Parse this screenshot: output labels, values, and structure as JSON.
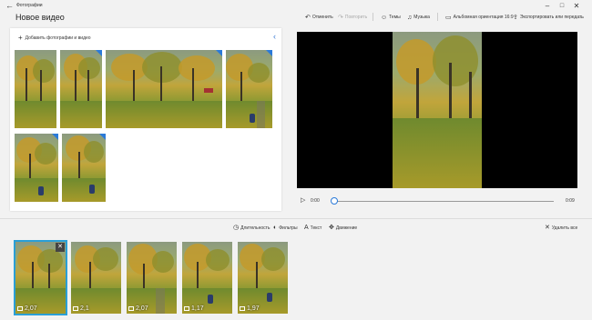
{
  "window": {
    "app_title": "Фотографии",
    "back_icon": "back-arrow-icon",
    "controls": [
      "minimize-icon",
      "maximize-icon",
      "close-icon"
    ]
  },
  "header": {
    "title": "Новое видео",
    "toolbar": {
      "undo": "Отменить",
      "redo": "Повторить",
      "themes": "Темы",
      "music": "Музыка",
      "aspect": "Альбомная ориентация 16:9",
      "export": "Экспортировать или передать",
      "more": "…"
    }
  },
  "library": {
    "add_label": "Добавить фотографии и видео",
    "thumbnails_count_rows": 2
  },
  "player": {
    "current_time": "0:00",
    "total_time": "0:09",
    "progress_fraction": 0.0
  },
  "storyboard": {
    "toolbar": {
      "duration": "Длительность",
      "filters": "Фильтры",
      "text": "Текст",
      "motion": "Движение",
      "delete_all": "Удалить все"
    },
    "items": [
      {
        "duration": "2,07",
        "selected": true
      },
      {
        "duration": "2,1",
        "selected": false
      },
      {
        "duration": "2,07",
        "selected": false
      },
      {
        "duration": "1,17",
        "selected": false
      },
      {
        "duration": "1,97",
        "selected": false
      }
    ]
  },
  "colors": {
    "accent": "#2a7ad9",
    "selection": "#2a9fd6",
    "preview_bg": "#000000"
  }
}
